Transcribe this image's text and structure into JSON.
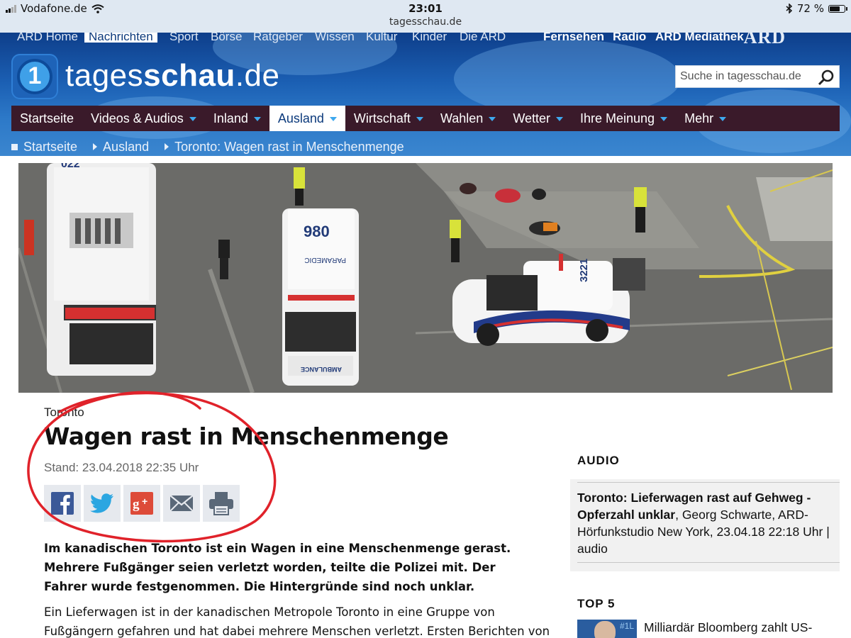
{
  "status_bar": {
    "carrier": "Vodafone.de",
    "time": "23:01",
    "url": "tagesschau.de",
    "battery": "72 %",
    "battery_level": 0.72
  },
  "ard_bar": {
    "links": [
      "ARD Home",
      "Nachrichten",
      "Sport",
      "Börse",
      "Ratgeber",
      "Wissen",
      "Kultur",
      "Kinder",
      "Die ARD"
    ],
    "active": "Nachrichten",
    "right_links": [
      "Fernsehen",
      "Radio",
      "ARD Mediathek"
    ],
    "logo": "ARD"
  },
  "brand": {
    "logo_digit": "1",
    "name_light": "tages",
    "name_bold": "schau",
    "name_tld": ".de"
  },
  "search": {
    "placeholder": "Suche in tagesschau.de"
  },
  "nav": {
    "items": [
      {
        "label": "Startseite",
        "caret": false,
        "active": false
      },
      {
        "label": "Videos & Audios",
        "caret": true,
        "active": false
      },
      {
        "label": "Inland",
        "caret": true,
        "active": false
      },
      {
        "label": "Ausland",
        "caret": true,
        "active": true
      },
      {
        "label": "Wirtschaft",
        "caret": true,
        "active": false
      },
      {
        "label": "Wahlen",
        "caret": true,
        "active": false
      },
      {
        "label": "Wetter",
        "caret": true,
        "active": false
      },
      {
        "label": "Ihre Meinung",
        "caret": true,
        "active": false
      },
      {
        "label": "Mehr",
        "caret": true,
        "active": false
      }
    ]
  },
  "breadcrumb": [
    "Startseite",
    "Ausland",
    "Toronto: Wagen rast in Menschenmenge"
  ],
  "photo": {
    "bus_number": "022",
    "ambulance_number": "980",
    "ambulance_roof_text": "PARAMEDIC",
    "ambulance_hood_text": "AMBULANCE",
    "police_number": "3221"
  },
  "article": {
    "kicker": "Toronto",
    "headline": "Wagen rast in Menschenmenge",
    "stand": "Stand: 23.04.2018 22:35 Uhr",
    "share": [
      "facebook-icon",
      "twitter-icon",
      "googleplus-icon",
      "mail-icon",
      "print-icon"
    ],
    "lead": "Im kanadischen Toronto ist ein Wagen in eine Menschenmenge gerast. Mehrere Fußgänger seien verletzt worden, teilte die Polizei mit. Der Fahrer wurde festgenommen. Die Hintergründe sind noch unklar.",
    "body": "Ein Lieferwagen ist in der kanadischen Metropole Toronto in eine Gruppe von Fußgängern gefahren und hat dabei mehrere Menschen verletzt. Ersten Berichten von"
  },
  "sidebar": {
    "audio_heading": "AUDIO",
    "audio_title": "Toronto: Lieferwagen rast auf Gehweg - Opferzahl unklar",
    "audio_meta": ", Georg Schwarte, ARD-Hörfunkstudio New York, 23.04.18 22:18 Uhr | audio",
    "top5_heading": "TOP 5",
    "top5_items": [
      {
        "text": "Milliardär Bloomberg zahlt US-Klimabeitrag",
        "thumb_text": "#1L"
      }
    ]
  },
  "colors": {
    "nav_bg": "#3a1a2a",
    "accent": "#3ea8ee",
    "annotation": "#e0222a"
  }
}
